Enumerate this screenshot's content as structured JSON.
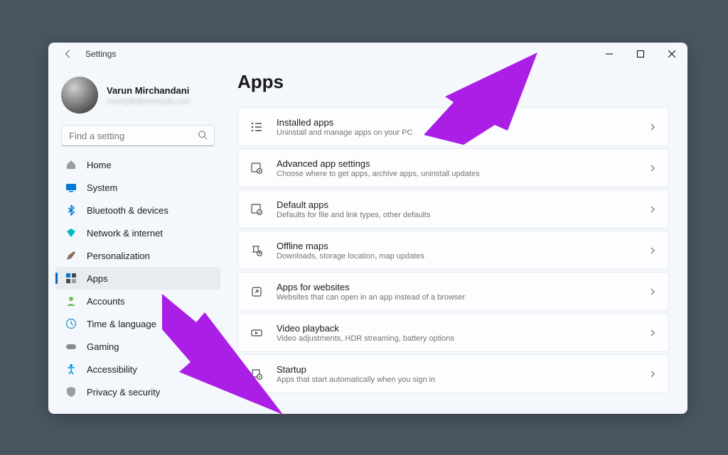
{
  "window": {
    "title": "Settings"
  },
  "profile": {
    "name": "Varun Mirchandani",
    "email": "example@example.com"
  },
  "search": {
    "placeholder": "Find a setting"
  },
  "nav": [
    {
      "label": "Home",
      "icon": "home"
    },
    {
      "label": "System",
      "icon": "system"
    },
    {
      "label": "Bluetooth & devices",
      "icon": "bluetooth"
    },
    {
      "label": "Network & internet",
      "icon": "network"
    },
    {
      "label": "Personalization",
      "icon": "personalization"
    },
    {
      "label": "Apps",
      "icon": "apps",
      "active": true
    },
    {
      "label": "Accounts",
      "icon": "accounts"
    },
    {
      "label": "Time & language",
      "icon": "time"
    },
    {
      "label": "Gaming",
      "icon": "gaming"
    },
    {
      "label": "Accessibility",
      "icon": "accessibility"
    },
    {
      "label": "Privacy & security",
      "icon": "privacy"
    }
  ],
  "page": {
    "title": "Apps"
  },
  "cards": [
    {
      "title": "Installed apps",
      "sub": "Uninstall and manage apps on your PC"
    },
    {
      "title": "Advanced app settings",
      "sub": "Choose where to get apps, archive apps, uninstall updates"
    },
    {
      "title": "Default apps",
      "sub": "Defaults for file and link types, other defaults"
    },
    {
      "title": "Offline maps",
      "sub": "Downloads, storage location, map updates"
    },
    {
      "title": "Apps for websites",
      "sub": "Websites that can open in an app instead of a browser"
    },
    {
      "title": "Video playback",
      "sub": "Video adjustments, HDR streaming, battery options"
    },
    {
      "title": "Startup",
      "sub": "Apps that start automatically when you sign in"
    }
  ],
  "annotations": {
    "arrow_color": "#aa1ee6"
  }
}
